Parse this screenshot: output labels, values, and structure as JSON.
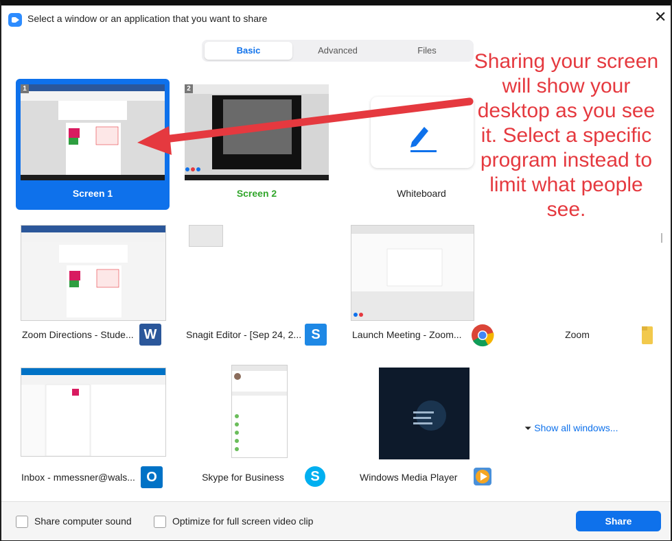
{
  "window": {
    "title": "Select a window or an application that you want to share",
    "close": "✕"
  },
  "tabs": [
    "Basic",
    "Advanced",
    "Files"
  ],
  "tiles": [
    {
      "label": "Screen 1",
      "badge": "1"
    },
    {
      "label": "Screen 2",
      "badge": "2"
    },
    {
      "label": "Whiteboard"
    },
    {
      "label": "Zoom Directions - Stude...",
      "icon": "word-icon",
      "icon_text": "W"
    },
    {
      "label": "Snagit Editor - [Sep 24, 2...",
      "icon": "snagit-icon",
      "icon_text": "S"
    },
    {
      "label": "Launch Meeting - Zoom...",
      "icon": "chrome-icon"
    },
    {
      "label": "Zoom",
      "icon": "folder-icon"
    },
    {
      "label": "Inbox - mmessner@wals...",
      "icon": "outlook-icon",
      "icon_text": "O"
    },
    {
      "label": "Skype for Business",
      "icon": "skype-icon",
      "icon_text": "S"
    },
    {
      "label": "Windows Media Player",
      "icon": "media-player-icon"
    }
  ],
  "show_all": "Show all windows...",
  "annotation": "Sharing your screen will show your desktop as you see it. Select a specific program instead to limit what people see.",
  "footer": {
    "share_sound": "Share computer sound",
    "optimize": "Optimize for full screen video clip",
    "share_button": "Share"
  },
  "colors": {
    "accent": "#0e71eb",
    "annotation": "#e5393f",
    "screen2_label": "#31a62b"
  }
}
